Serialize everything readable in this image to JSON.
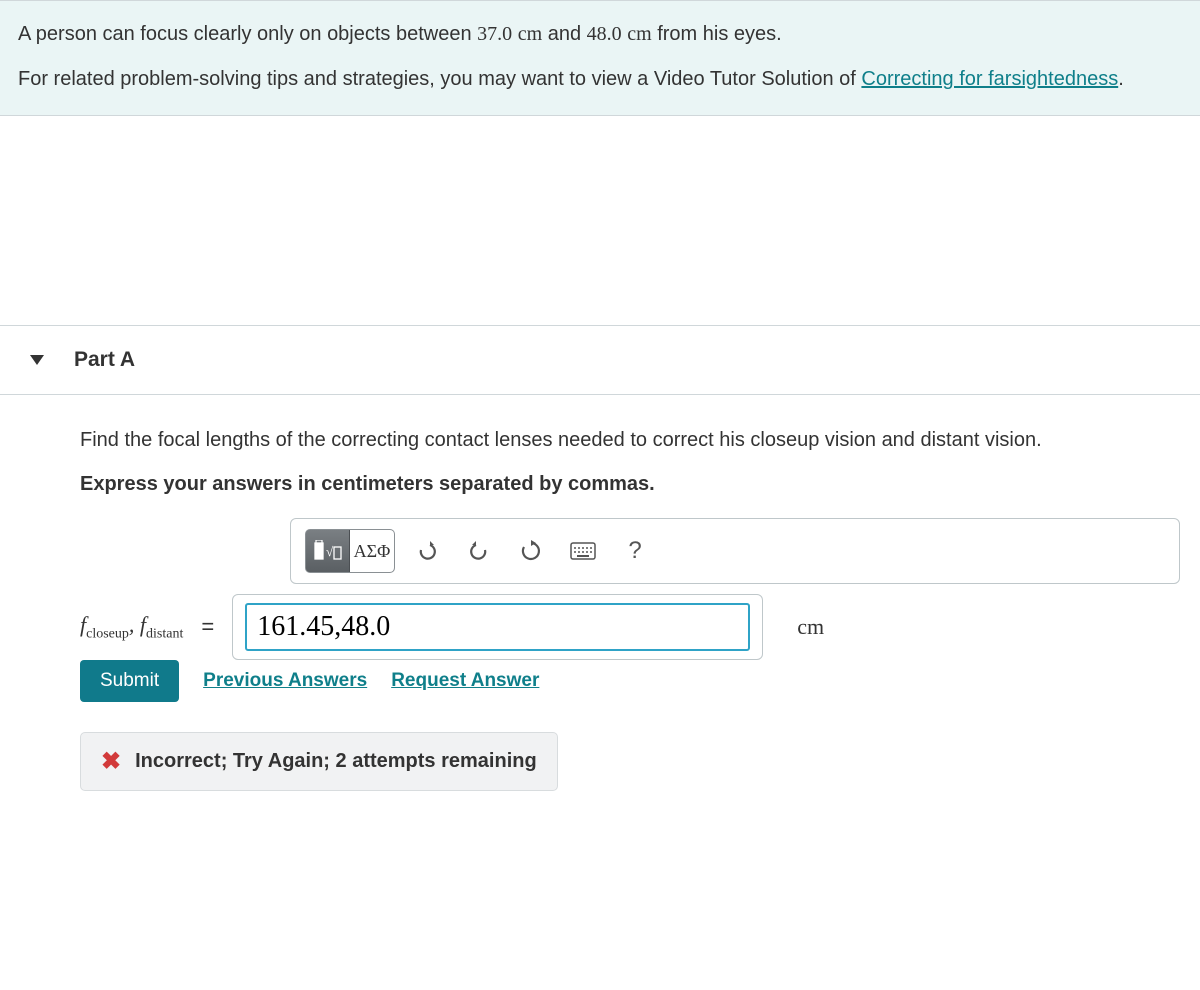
{
  "intro": {
    "text_a": "A person can focus clearly only on objects between ",
    "near": "37.0",
    "unit1": "cm",
    "text_b": " and ",
    "far": "48.0",
    "unit2": "cm",
    "text_c": " from his eyes.",
    "text_d": "For related problem-solving tips and strategies, you may want to view a Video Tutor Solution of ",
    "link_text": "Correcting for farsightedness",
    "period": "."
  },
  "part": {
    "title": "Part A",
    "question": "Find the focal lengths of the correcting contact lenses needed to correct his closeup vision and distant vision.",
    "instructions": "Express your answers in centimeters separated by commas."
  },
  "toolbar": {
    "templates_label": "▯√▯",
    "greek_label": "ΑΣΦ",
    "undo_label": "↶",
    "redo_label": "↷",
    "reset_label": "↻",
    "keyboard_label": "⌨",
    "help_label": "?"
  },
  "answer": {
    "var_prefix_f": "f",
    "sub_closeup": "closeup",
    "comma": ", ",
    "sub_distant": "distant",
    "equals": " = ",
    "value": "161.45,48.0",
    "unit": "cm"
  },
  "actions": {
    "submit": "Submit",
    "previous": "Previous Answers",
    "request": "Request Answer"
  },
  "feedback": {
    "icon": "✖",
    "text": "Incorrect; Try Again; 2 attempts remaining"
  }
}
